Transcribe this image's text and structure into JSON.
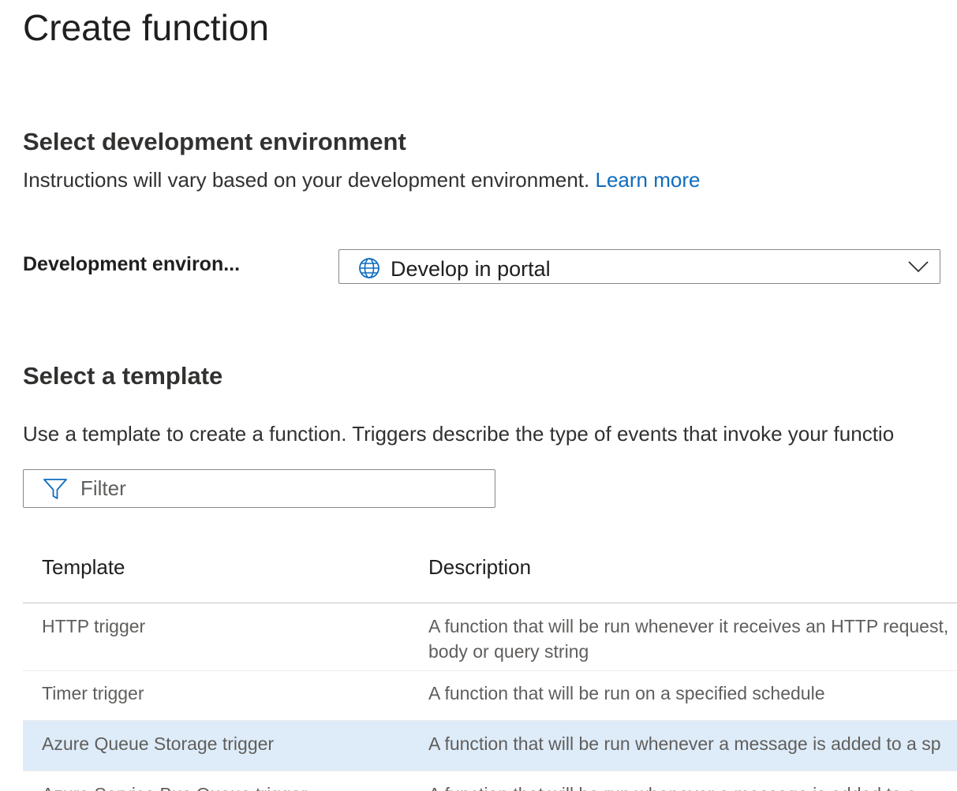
{
  "page": {
    "title": "Create function"
  },
  "dev_env_section": {
    "heading": "Select development environment",
    "description": "Instructions will vary based on your development environment.",
    "learn_more": "Learn more",
    "field_label": "Development environ...",
    "selected_value": "Develop in portal"
  },
  "template_section": {
    "heading": "Select a template",
    "description": "Use a template to create a function. Triggers describe the type of events that invoke your functio",
    "filter_placeholder": "Filter"
  },
  "table": {
    "columns": [
      "Template",
      "Description"
    ],
    "rows": [
      {
        "template": "HTTP trigger",
        "description": "A function that will be run whenever it receives an HTTP request, body or query string",
        "selected": false
      },
      {
        "template": "Timer trigger",
        "description": "A function that will be run on a specified schedule",
        "selected": false
      },
      {
        "template": "Azure Queue Storage trigger",
        "description": "A function that will be run whenever a message is added to a sp",
        "selected": true
      },
      {
        "template": "Azure Service Bus Queue trigger",
        "description": "A function that will be run whenever a message is added to a",
        "selected": false
      }
    ]
  },
  "icons": {
    "environment": "globe-icon",
    "dropdown": "chevron-down-icon",
    "filter": "funnel-icon"
  },
  "colors": {
    "accent": "#0f6cbd",
    "selected_row": "#deecf9",
    "border": "#8a8886"
  }
}
